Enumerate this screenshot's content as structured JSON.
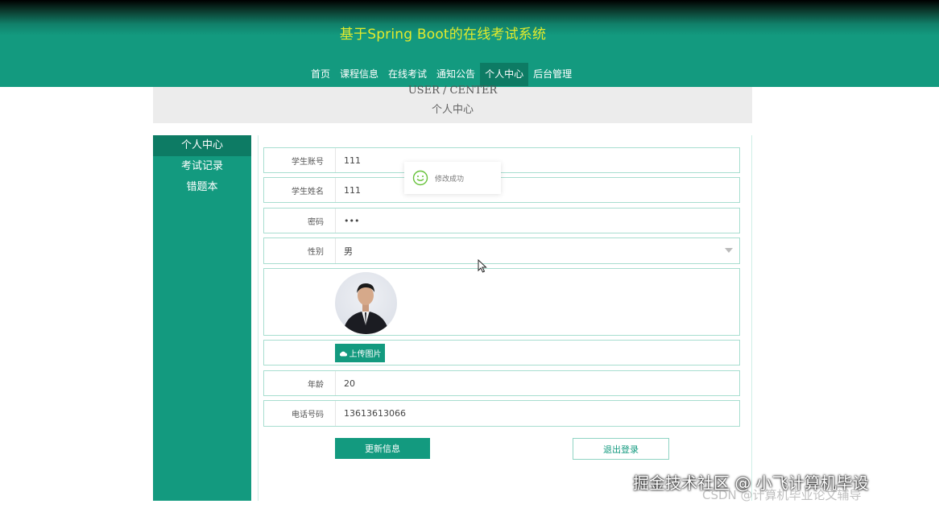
{
  "header": {
    "title": "基于Spring Boot的在线考试系统",
    "nav": [
      "首页",
      "课程信息",
      "在线考试",
      "通知公告",
      "个人中心",
      "后台管理"
    ],
    "active_nav": "个人中心"
  },
  "banner": {
    "en": "USER / CENTER",
    "cn": "个人中心"
  },
  "sidebar": {
    "items": [
      "个人中心",
      "考试记录",
      "错题本"
    ],
    "active": "个人中心"
  },
  "form": {
    "account_label": "学生账号",
    "account_value": "111",
    "name_label": "学生姓名",
    "name_value": "111",
    "password_label": "密码",
    "password_value": "•••",
    "gender_label": "性别",
    "gender_value": "男",
    "upload_label": "上传图片",
    "age_label": "年龄",
    "age_value": "20",
    "phone_label": "电话号码",
    "phone_value": "13613613066"
  },
  "buttons": {
    "update": "更新信息",
    "logout": "退出登录"
  },
  "toast": {
    "text": "修改成功"
  },
  "icons": {
    "toast": "smile-icon",
    "upload": "cloud-upload-icon",
    "cursor": "mouse-cursor-icon"
  },
  "colors": {
    "primary": "#139a7f",
    "title": "#e3ea2c"
  },
  "watermark": {
    "line1": "掘金技术社区 @ 小飞计算机毕设",
    "line2": "CSDN @计算机毕业论文辅导"
  }
}
